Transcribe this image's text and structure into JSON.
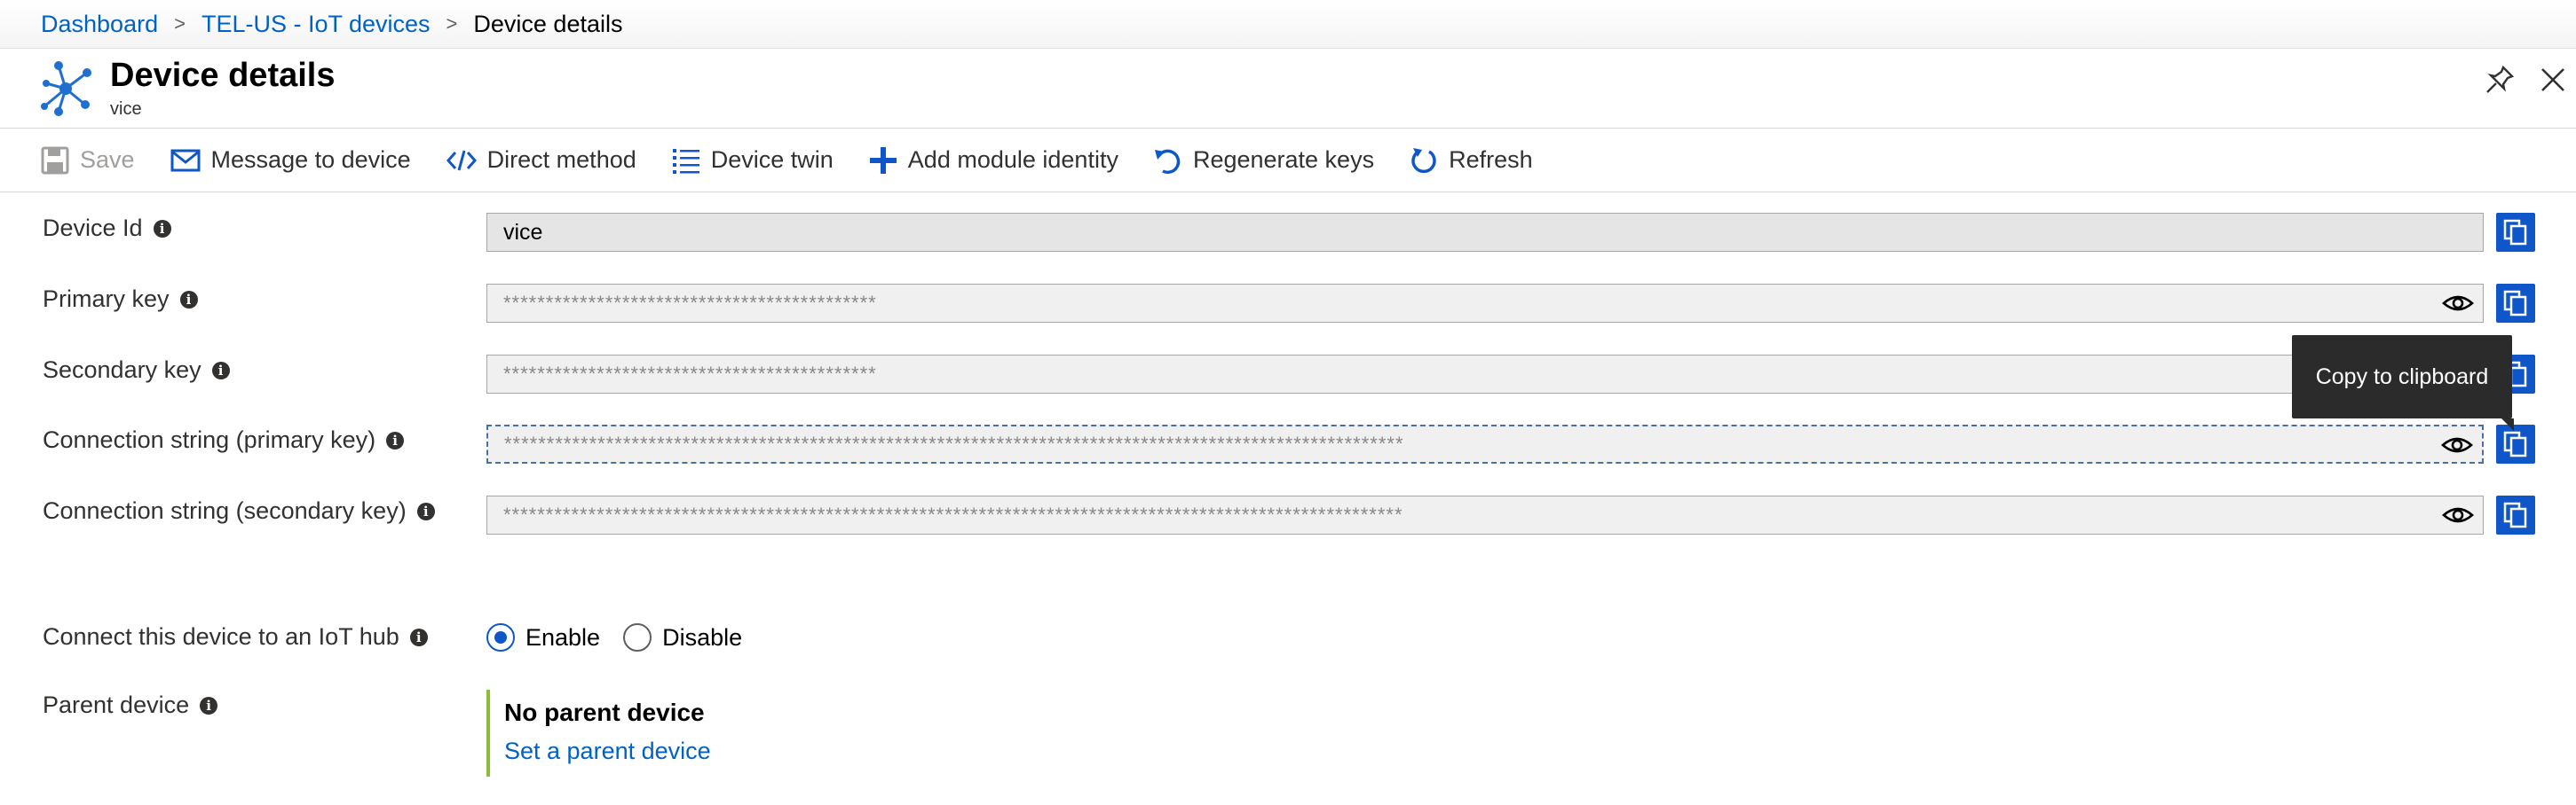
{
  "breadcrumb": {
    "items": [
      "Dashboard",
      "TEL-US - IoT devices"
    ],
    "current": "Device details"
  },
  "header": {
    "title": "Device details",
    "subtitle": "vice"
  },
  "toolbar": {
    "save": "Save",
    "message": "Message to device",
    "direct_method": "Direct method",
    "device_twin": "Device twin",
    "add_module": "Add module identity",
    "regenerate": "Regenerate keys",
    "refresh": "Refresh"
  },
  "fields": {
    "device_id": {
      "label": "Device Id",
      "value": "vice"
    },
    "primary_key": {
      "label": "Primary key",
      "value": "********************************************"
    },
    "secondary_key": {
      "label": "Secondary key",
      "value": "********************************************"
    },
    "conn_primary": {
      "label": "Connection string (primary key)",
      "value": "**********************************************************************************************************"
    },
    "conn_secondary": {
      "label": "Connection string (secondary key)",
      "value": "**********************************************************************************************************"
    }
  },
  "tooltip": "Copy to clipboard",
  "connect": {
    "label": "Connect this device to an IoT hub",
    "enable": "Enable",
    "disable": "Disable",
    "selected": "Enable"
  },
  "parent": {
    "label": "Parent device",
    "title": "No parent device",
    "link": "Set a parent device"
  },
  "colors": {
    "accent": "#0f57c9",
    "link": "#0062c4",
    "parent_bar": "#8cbd3a"
  },
  "icons": [
    "hub-icon",
    "pin-icon",
    "close-icon",
    "save-icon",
    "mail-icon",
    "code-icon",
    "list-icon",
    "plus-icon",
    "regenerate-icon",
    "refresh-icon",
    "info-icon",
    "eye-icon",
    "copy-icon"
  ]
}
